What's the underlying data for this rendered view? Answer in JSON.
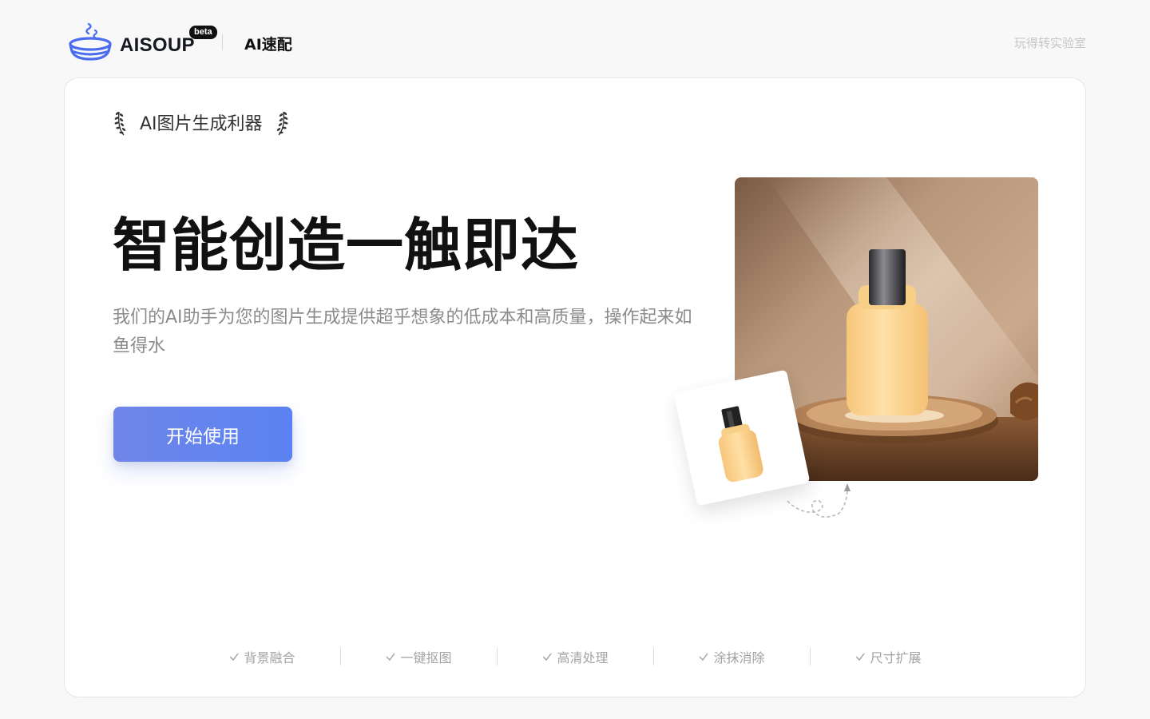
{
  "header": {
    "logo_text": "AISOUP",
    "beta_label": "beta",
    "product_name": "AI速配",
    "lab_link": "玩得转实验室"
  },
  "hero": {
    "tagline": "AI图片生成利器",
    "title": "智能创造一触即达",
    "description": "我们的AI助手为您的图片生成提供超乎想象的低成本和高质量，操作起来如鱼得水",
    "cta_label": "开始使用"
  },
  "features": [
    {
      "label": "背景融合"
    },
    {
      "label": "一键抠图"
    },
    {
      "label": "高清处理"
    },
    {
      "label": "涂抹消除"
    },
    {
      "label": "尺寸扩展"
    }
  ],
  "colors": {
    "accent": "#5b82f3",
    "logo_blue": "#4a6cf0",
    "bottle": "#ffd38a"
  },
  "icons": {
    "logo": "soup-bowl-icon",
    "laurel": "laurel-icon",
    "check": "check-icon",
    "arrow": "dashed-loop-arrow-icon"
  }
}
